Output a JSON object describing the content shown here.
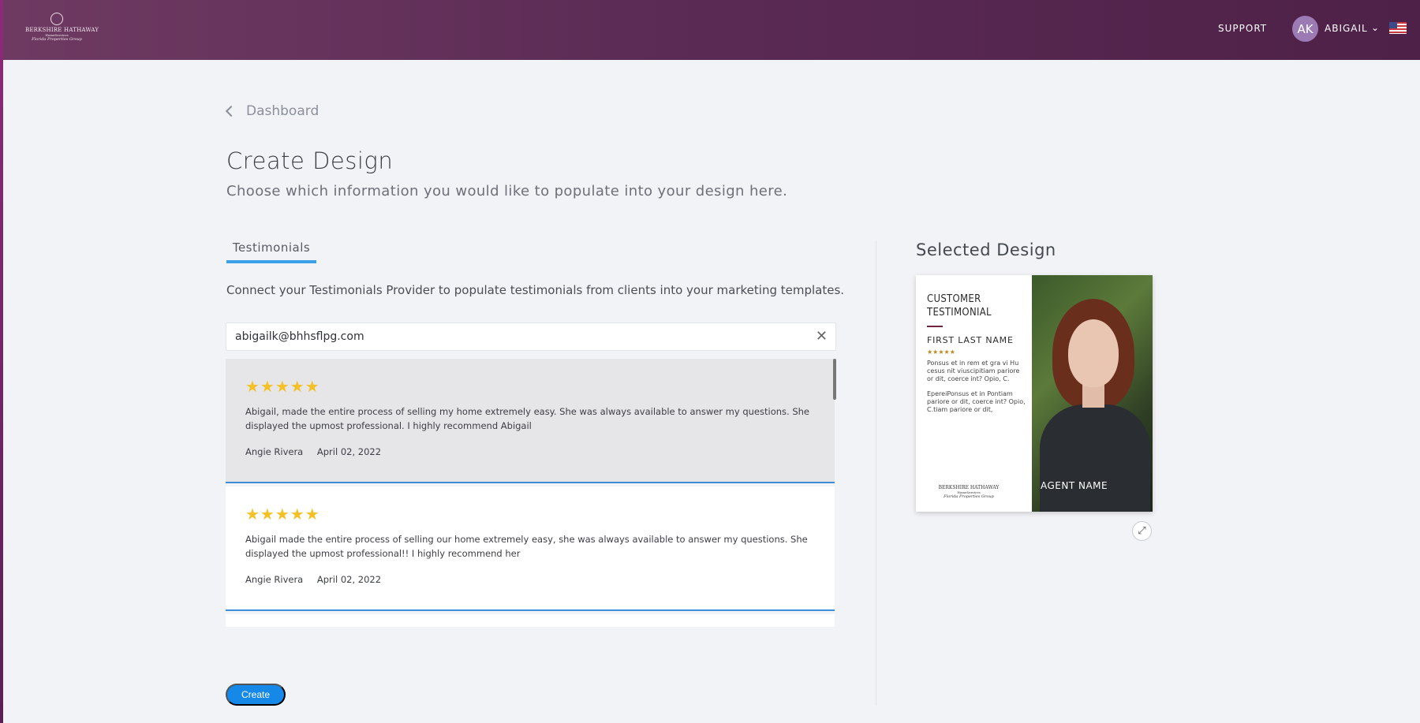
{
  "header": {
    "logo": {
      "line1": "BERKSHIRE HATHAWAY",
      "line2": "HomeServices",
      "line3": "Florida Properties Group"
    },
    "support_label": "SUPPORT",
    "user": {
      "initials": "AK",
      "name": "ABIGAIL"
    },
    "flag_icon": "us-flag-icon"
  },
  "nav": {
    "back_label": "Dashboard"
  },
  "page": {
    "title": "Create Design",
    "subtitle": "Choose which information you would like to populate into your design here."
  },
  "tabs": [
    {
      "label": "Testimonials",
      "active": true
    }
  ],
  "testimonials": {
    "description": "Connect your Testimonials Provider to populate testimonials from clients into your marketing templates.",
    "search_value": "abigailk@bhhsflpg.com",
    "items": [
      {
        "stars": "★★★★★",
        "rating": 5,
        "text": "Abigail, made the entire process of selling my home extremely easy. She was always available to answer my questions. She displayed the upmost professional. I highly recommend Abigail",
        "author": "Angie Rivera",
        "date": "April 02, 2022"
      },
      {
        "stars": "★★★★★",
        "rating": 5,
        "text": "Abigail made the entire process of selling our home extremely easy, she was always available to answer my questions. She displayed the upmost professional!! I highly recommend her",
        "author": "Angie Rivera",
        "date": "April 02, 2022"
      }
    ]
  },
  "actions": {
    "create_label": "Create"
  },
  "selected_design": {
    "title": "Selected Design",
    "heading_line1": "CUSTOMER",
    "heading_line2": "TESTIMONIAL",
    "name_placeholder": "FIRST LAST NAME",
    "stars": "★★★★★",
    "body1": "Ponsus et in rem et gra vi Hu cesus nit viuscipitiam pariore or dit, coerce int? Opio, C.",
    "body2": "EpereiPonsus et in Pontiam pariore or dit, coerce int? Opio, C.tiam pariore or dit,",
    "logo_line1": "BERKSHIRE HATHAWAY",
    "logo_line2": "HomeServices",
    "logo_line3": "Florida Properties Group",
    "agent_label": "AGENT NAME"
  },
  "colors": {
    "header": "#5a2a54",
    "accent": "#1588e8",
    "tab_underline": "#3aa0e8",
    "stars": "#f5c024"
  }
}
